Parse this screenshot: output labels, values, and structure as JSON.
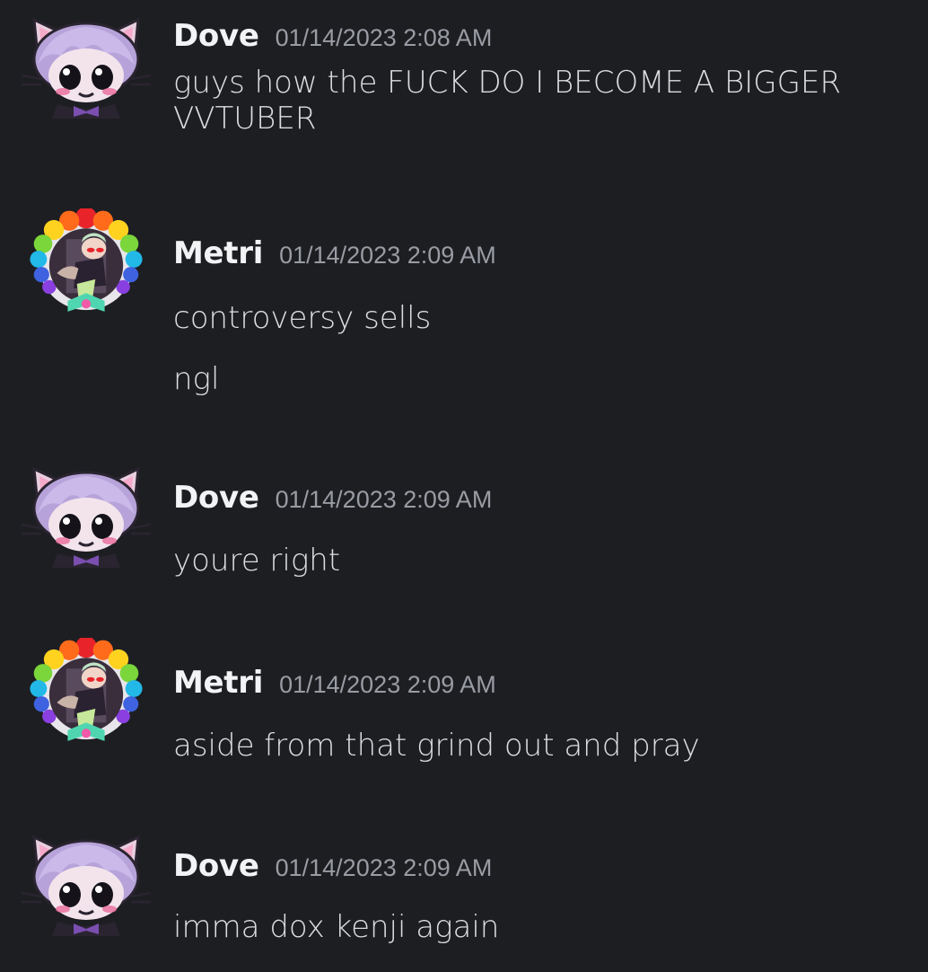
{
  "theme": {
    "background": "#1d1e22",
    "author_color": "#f2f3f5",
    "timestamp_color": "#9a9ca4",
    "text_color": "#dcdde1"
  },
  "messages": [
    {
      "author": "Dove",
      "timestamp": "01/14/2023 2:08 AM",
      "avatar": "dove-avatar",
      "lines": [
        "guys how the FUCK DO I BECOME A BIGGER VVTUBER"
      ]
    },
    {
      "author": "Metri",
      "timestamp": "01/14/2023 2:09 AM",
      "avatar": "metri-avatar",
      "lines": [
        "controversy sells",
        "ngl"
      ]
    },
    {
      "author": "Dove",
      "timestamp": "01/14/2023 2:09 AM",
      "avatar": "dove-avatar",
      "lines": [
        "youre right"
      ]
    },
    {
      "author": "Metri",
      "timestamp": "01/14/2023 2:09 AM",
      "avatar": "metri-avatar",
      "lines": [
        "aside from that grind out and pray"
      ]
    },
    {
      "author": "Dove",
      "timestamp": "01/14/2023 2:09 AM",
      "avatar": "dove-avatar",
      "lines": [
        "imma dox kenji again"
      ]
    }
  ]
}
